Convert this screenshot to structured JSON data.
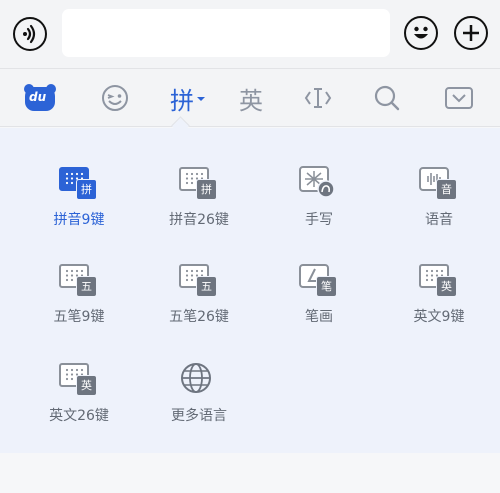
{
  "topbar": {
    "voice_icon": "voice-icon",
    "input_value": "",
    "emoji_icon": "emoji-face-icon",
    "add_icon": "plus-icon"
  },
  "toolbar": {
    "logo_text": "du",
    "pinyin_label": "拼",
    "english_label": "英",
    "accent_color": "#2c63d6"
  },
  "input_methods": [
    {
      "label": "拼音9键",
      "badge": "拼",
      "icon": "keyboard-icon",
      "selected": true
    },
    {
      "label": "拼音26键",
      "badge": "拼",
      "icon": "keyboard-icon",
      "selected": false
    },
    {
      "label": "手写",
      "badge": "",
      "icon": "handwriting-icon",
      "selected": false
    },
    {
      "label": "语音",
      "badge": "音",
      "icon": "voice-wave-icon",
      "selected": false
    },
    {
      "label": "五笔9键",
      "badge": "五",
      "icon": "keyboard-icon",
      "selected": false
    },
    {
      "label": "五笔26键",
      "badge": "五",
      "icon": "keyboard-icon",
      "selected": false
    },
    {
      "label": "笔画",
      "badge": "笔",
      "icon": "stroke-icon",
      "selected": false
    },
    {
      "label": "英文9键",
      "badge": "英",
      "icon": "keyboard-icon",
      "selected": false
    },
    {
      "label": "英文26键",
      "badge": "英",
      "icon": "keyboard-icon",
      "selected": false
    },
    {
      "label": "更多语言",
      "badge": "",
      "icon": "globe-icon",
      "selected": false
    }
  ]
}
